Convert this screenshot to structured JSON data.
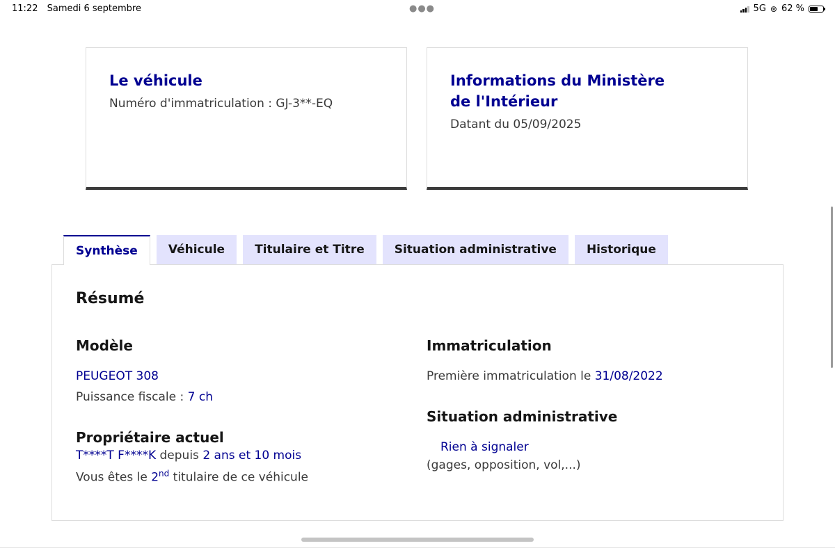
{
  "status_bar": {
    "time": "11:22",
    "date": "Samedi 6 septembre",
    "network": "5G",
    "battery": "62 %"
  },
  "cards": {
    "vehicle": {
      "title": "Le véhicule",
      "text": "Numéro d'immatriculation : GJ-3**-EQ"
    },
    "ministry": {
      "title": "Informations du Ministère de l'Intérieur",
      "text": "Datant du 05/09/2025"
    }
  },
  "tabs": [
    {
      "label": "Synthèse",
      "active": true
    },
    {
      "label": "Véhicule",
      "active": false
    },
    {
      "label": "Titulaire et Titre",
      "active": false
    },
    {
      "label": "Situation administrative",
      "active": false
    },
    {
      "label": "Historique",
      "active": false
    }
  ],
  "summary": {
    "title": "Résumé",
    "model": {
      "heading": "Modèle",
      "name": "PEUGEOT 308",
      "power_label": "Puissance fiscale : ",
      "power_value": "7 ch"
    },
    "owner": {
      "heading": "Propriétaire actuel",
      "name": "T****T F****K",
      "since_label": " depuis ",
      "since_value": "2 ans et 10 mois",
      "rank_prefix": "Vous êtes le ",
      "rank_number": "2",
      "rank_suffix": "nd",
      "rank_after": " titulaire de ce véhicule"
    },
    "registration": {
      "heading": "Immatriculation",
      "first_label": "Première immatriculation le ",
      "first_value": "31/08/2022"
    },
    "admin": {
      "heading": "Situation administrative",
      "status": "Rien à signaler",
      "detail": "(gages, opposition, vol,...)"
    }
  },
  "colors": {
    "accent": "#000091",
    "tab_bg": "#e3e3fd"
  }
}
